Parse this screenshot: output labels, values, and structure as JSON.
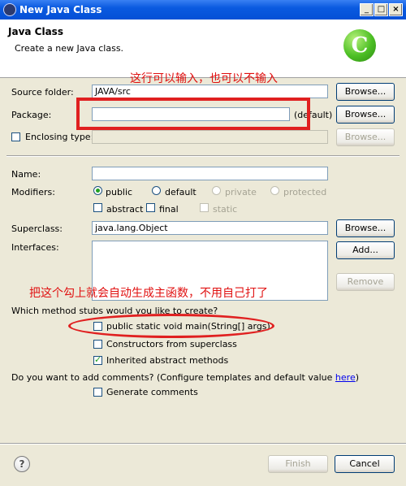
{
  "window": {
    "title": "New Java Class"
  },
  "header": {
    "title": "Java Class",
    "description": "Create a new Java class.",
    "logo_letter": "C"
  },
  "annotations": {
    "top": "这行可以输入，也可以不输入",
    "middle": "把这个勾上就会自动生成主函数，不用自己打了"
  },
  "form": {
    "source_folder": {
      "label": "Source folder:",
      "value": "JAVA/src",
      "button": "Browse..."
    },
    "package": {
      "label": "Package:",
      "value": "",
      "hint": "(default)",
      "button": "Browse..."
    },
    "enclosing_type": {
      "label": "Enclosing type:",
      "value": "",
      "button": "Browse...",
      "checked": false
    },
    "name": {
      "label": "Name:",
      "value": ""
    },
    "modifiers": {
      "label": "Modifiers:",
      "access": [
        "public",
        "default",
        "private",
        "protected"
      ],
      "other": [
        "abstract",
        "final",
        "static"
      ]
    },
    "superclass": {
      "label": "Superclass:",
      "value": "java.lang.Object",
      "button": "Browse..."
    },
    "interfaces": {
      "label": "Interfaces:",
      "add_button": "Add...",
      "remove_button": "Remove"
    },
    "stubs": {
      "question": "Which method stubs would you like to create?",
      "items": [
        {
          "label": "public static void main(String[] args)",
          "checked": false
        },
        {
          "label": "Constructors from superclass",
          "checked": false
        },
        {
          "label": "Inherited abstract methods",
          "checked": true
        }
      ]
    },
    "comments": {
      "question": "Do you want to add comments? (Configure templates and default value ",
      "link": "here",
      "tail": ")",
      "generate": {
        "label": "Generate comments",
        "checked": false
      }
    }
  },
  "footer": {
    "help": "?",
    "finish": "Finish",
    "cancel": "Cancel"
  }
}
